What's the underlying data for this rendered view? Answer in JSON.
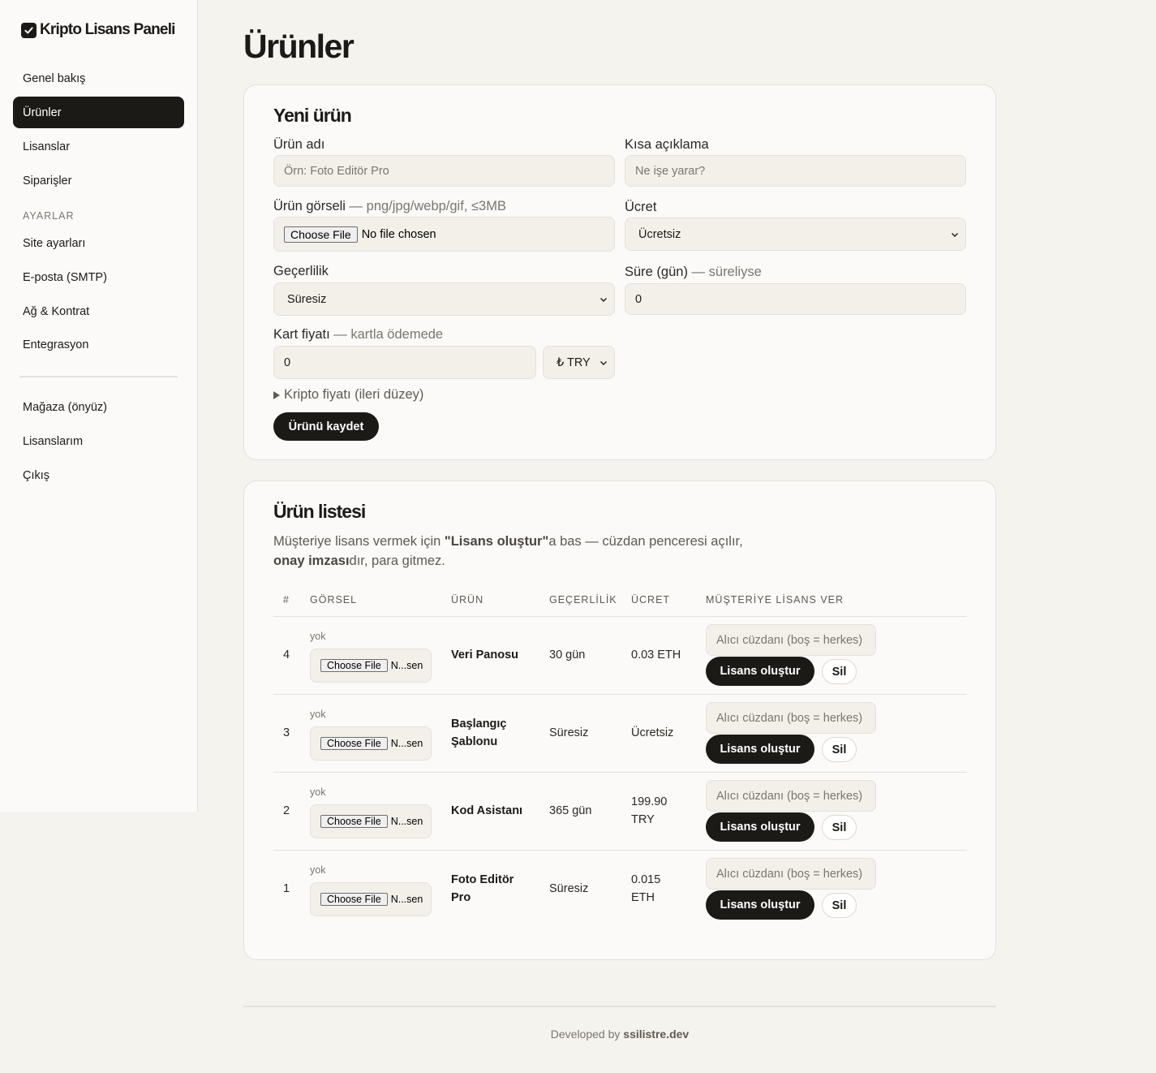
{
  "brand": {
    "title": "Kripto Lisans Paneli",
    "icon": "checkbox-icon"
  },
  "sidebar": {
    "items": [
      "Genel bakış",
      "Ürünler",
      "Lisanslar",
      "Siparişler"
    ],
    "section_label": "AYARLAR",
    "settings_items": [
      "Site ayarları",
      "E-posta (SMTP)",
      "Ağ & Kontrat",
      "Entegrasyon"
    ],
    "bottom_items": [
      "Mağaza (önyüz)",
      "Lisanslarım",
      "Çıkış"
    ]
  },
  "page": {
    "title": "Ürünler"
  },
  "new_product": {
    "title": "Yeni ürün",
    "name_label": "Ürün adı",
    "name_placeholder": "Örn: Foto Editör Pro",
    "short_desc_label": "Kısa açıklama",
    "short_desc_placeholder": "Ne işe yarar?",
    "image_label": "Ürün görseli",
    "image_hint": " — png/jpg/webp/gif, ≤3MB",
    "file_button": "Choose File",
    "file_status": "No file chosen",
    "price_label": "Ücret",
    "price_value": "Ücretsiz",
    "validity_label": "Geçerlilik",
    "validity_value": "Süresiz",
    "duration_label": "Süre (gün)",
    "duration_hint": " — süreliyse",
    "duration_value": "0",
    "card_price_label": "Kart fiyatı",
    "card_price_hint": " — kartla ödemede",
    "card_price_value": "0",
    "currency_value": "₺ TRY",
    "crypto_details": "Kripto fiyatı (ileri düzey)",
    "save_button": "Ürünü kaydet"
  },
  "product_list": {
    "title": "Ürün listesi",
    "desc_1": "Müşteriye lisans vermek için ",
    "desc_bold_1": "\"Lisans oluştur\"",
    "desc_2": "a bas — cüzdan penceresi açılır,",
    "desc_bold_2": "onay imzası",
    "desc_3": "dır, para gitmez.",
    "columns": [
      "#",
      "GÖRSEL",
      "ÜRÜN",
      "GEÇERLİLİK",
      "ÜCRET",
      "MÜŞTERİYE LİSANS VER"
    ],
    "image_none": "yok",
    "file_button": "Choose File",
    "file_status_short": "N...sen",
    "wallet_placeholder": "Alıcı cüzdanı (boş = herkes)",
    "create_button": "Lisans oluştur",
    "delete_button": "Sil",
    "rows": [
      {
        "id": "4",
        "name_1": "Veri Panosu",
        "name_2": "",
        "validity": "30 gün",
        "price_1": "0.03 ETH",
        "price_2": ""
      },
      {
        "id": "3",
        "name_1": "Başlangıç",
        "name_2": "Şablonu",
        "validity": "Süresiz",
        "price_1": "Ücretsiz",
        "price_2": ""
      },
      {
        "id": "2",
        "name_1": "Kod Asistanı",
        "name_2": "",
        "validity": "365 gün",
        "price_1": "199.90",
        "price_2": "TRY"
      },
      {
        "id": "1",
        "name_1": "Foto Editör",
        "name_2": "Pro",
        "validity": "Süresiz",
        "price_1": "0.015",
        "price_2": "ETH"
      }
    ]
  },
  "footer": {
    "prefix": "Developed by ",
    "link": "ssilistre.dev"
  }
}
